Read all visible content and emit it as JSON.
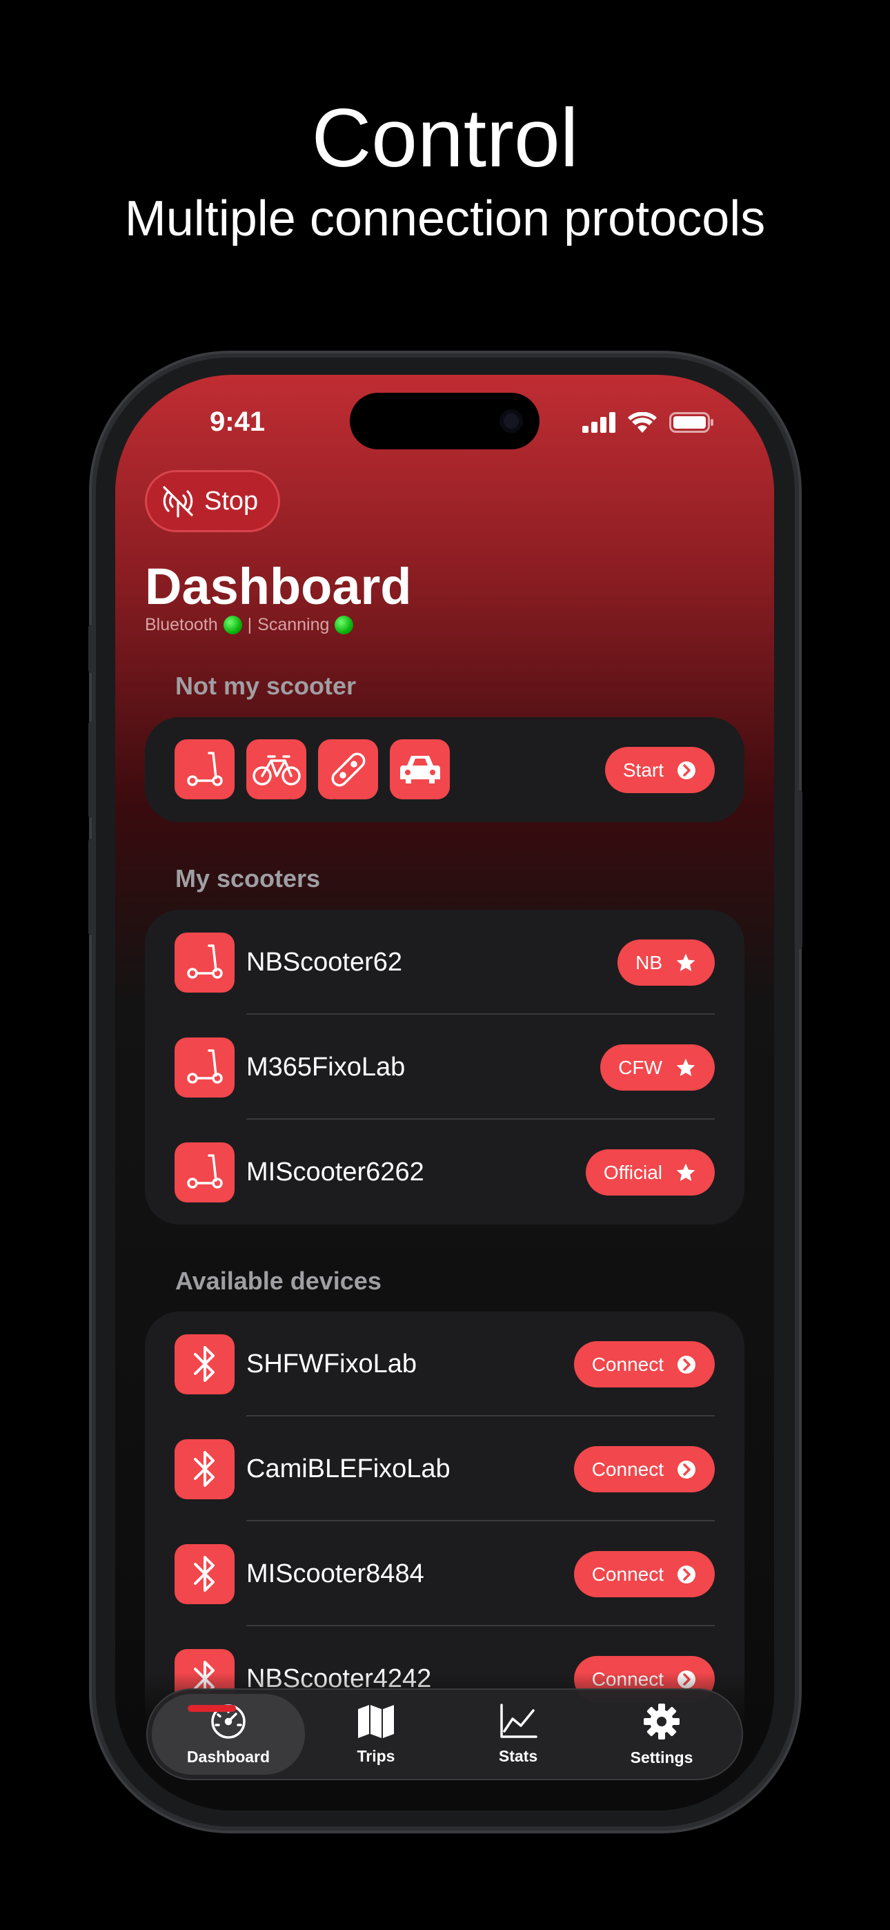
{
  "hero": {
    "title": "Control",
    "subtitle": "Multiple connection protocols"
  },
  "status_bar": {
    "time": "9:41"
  },
  "header": {
    "stop_label": "Stop",
    "title": "Dashboard",
    "status_bluetooth": "Bluetooth",
    "status_separator": "|",
    "status_scanning": "Scanning"
  },
  "not_my_scooter": {
    "label": "Not my scooter",
    "vehicle_icons": [
      "scooter-icon",
      "bicycle-icon",
      "skateboard-icon",
      "car-icon"
    ],
    "start_label": "Start"
  },
  "my_scooters": {
    "label": "My scooters",
    "items": [
      {
        "name": "NBScooter62",
        "badge": "NB"
      },
      {
        "name": "M365FixoLab",
        "badge": "CFW"
      },
      {
        "name": "MIScooter6262",
        "badge": "Official"
      }
    ]
  },
  "available_devices": {
    "label": "Available devices",
    "items": [
      {
        "name": "SHFWFixoLab",
        "action": "Connect"
      },
      {
        "name": "CamiBLEFixoLab",
        "action": "Connect"
      },
      {
        "name": "MIScooter8484",
        "action": "Connect"
      },
      {
        "name": "NBScooter4242",
        "action": "Connect"
      }
    ]
  },
  "tabs": [
    {
      "label": "Dashboard",
      "icon": "speedometer-icon",
      "active": true
    },
    {
      "label": "Trips",
      "icon": "map-icon",
      "active": false
    },
    {
      "label": "Stats",
      "icon": "chart-icon",
      "active": false
    },
    {
      "label": "Settings",
      "icon": "gear-icon",
      "active": false
    }
  ],
  "colors": {
    "accent": "#f2474c",
    "card": "#1c1c1e",
    "status_dot": "#1fcf1f"
  }
}
